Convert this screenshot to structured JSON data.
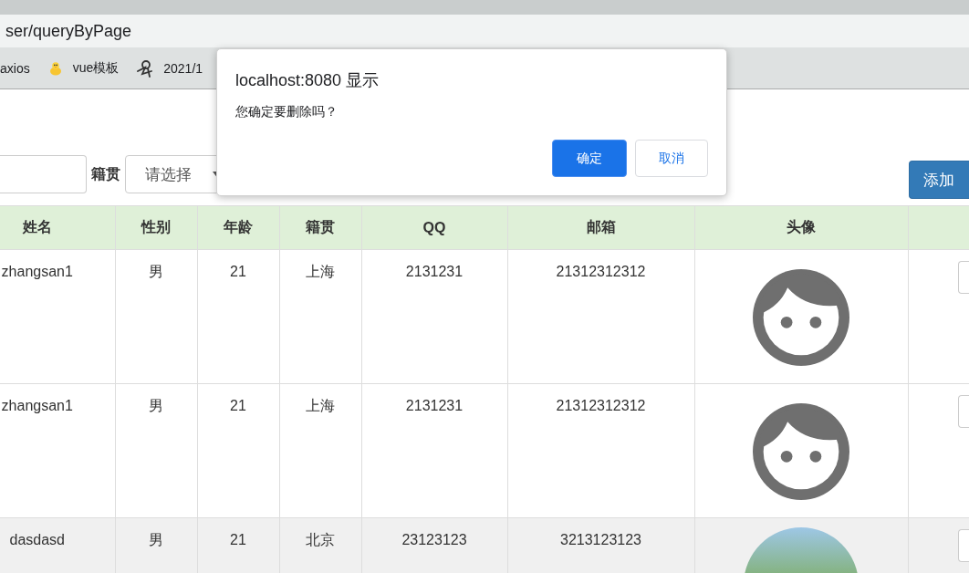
{
  "browser": {
    "address": "ser/queryByPage",
    "bookmarks": [
      {
        "label": "axios",
        "kind": "plain"
      },
      {
        "label": "vue模板",
        "kind": "emoji"
      },
      {
        "label": "2021/1",
        "kind": "favicon"
      }
    ]
  },
  "search": {
    "origin_label": "籍贯",
    "origin_select": {
      "placeholder": "请选择"
    },
    "add_button": "添加"
  },
  "table": {
    "columns": [
      "姓名",
      "性别",
      "年龄",
      "籍贯",
      "QQ",
      "邮箱",
      "头像"
    ],
    "rows": [
      {
        "name": "zhangsan1",
        "gender": "男",
        "age": "21",
        "origin": "上海",
        "qq": "2131231",
        "email": "21312312312",
        "avatar": {
          "kind": "default"
        },
        "highlighted": false
      },
      {
        "name": "zhangsan1",
        "gender": "男",
        "age": "21",
        "origin": "上海",
        "qq": "2131231",
        "email": "21312312312",
        "avatar": {
          "kind": "default"
        },
        "highlighted": false
      },
      {
        "name": "dasdasd",
        "gender": "男",
        "age": "21",
        "origin": "北京",
        "qq": "23123123",
        "email": "3213123123",
        "avatar": {
          "kind": "photo"
        },
        "highlighted": true
      }
    ]
  },
  "dialog": {
    "title": "localhost:8080 显示",
    "message": "您确定要删除吗？",
    "buttons": [
      {
        "label": "确定",
        "kind": "primary"
      },
      {
        "label": "取消",
        "kind": "secondary"
      }
    ]
  }
}
